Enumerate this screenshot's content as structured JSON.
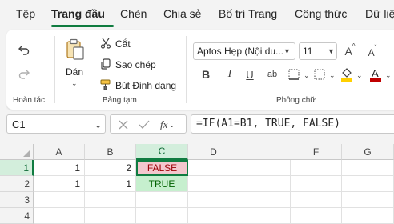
{
  "tabs": [
    "Tệp",
    "Trang đầu",
    "Chèn",
    "Chia sẻ",
    "Bố trí Trang",
    "Công thức",
    "Dữ liệ"
  ],
  "ribbon": {
    "undo_group_label": "Hoàn tác",
    "paste_label": "Dán",
    "cut_label": "Cắt",
    "copy_label": "Sao chép",
    "format_painter_label": "Bút Định dạng",
    "clipboard_group_label": "Bảng tạm",
    "font_name": "Aptos Hẹp (Nội du...",
    "font_size": "11",
    "font_group_label": "Phông chữ",
    "bold": "B",
    "italic": "I",
    "underline": "U",
    "strike": "ab",
    "grow_font": "A",
    "shrink_font": "A"
  },
  "formula_bar": {
    "name_box": "C1",
    "fx": "fx",
    "formula": "=IF(A1=B1, TRUE, FALSE)"
  },
  "grid": {
    "columns": [
      "A",
      "B",
      "C",
      "D",
      "F",
      "G"
    ],
    "rows": [
      "1",
      "2",
      "3",
      "4"
    ],
    "cells": {
      "A1": "1",
      "B1": "2",
      "C1": "FALSE",
      "A2": "1",
      "B2": "1",
      "C2": "TRUE"
    }
  },
  "colors": {
    "accent": "#107c41",
    "false_fill": "#f4c7ce",
    "false_text": "#9c0006",
    "true_fill": "#c6efce",
    "true_text": "#006100"
  }
}
